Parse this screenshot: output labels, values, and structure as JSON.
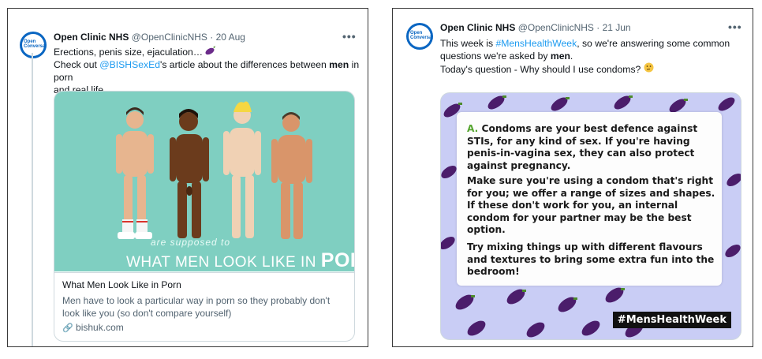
{
  "left": {
    "author": "Open Clinic NHS",
    "handle": "@OpenClinicNHS",
    "date": "· 20 Aug",
    "more": "•••",
    "line1": "Erections, penis size, ejaculation…",
    "line2_pre": "Check out ",
    "mention": "@BISHSexEd",
    "line2_post": "'s article about the differences between ",
    "bold": "men",
    "line2_end": " in porn",
    "line3": "and real life.",
    "poster_sub": "are supposed to",
    "poster_main": "WHAT MEN LOOK LIKE IN",
    "poster_big": "PORN",
    "card_title": "What Men Look Like in Porn",
    "card_desc": "Men have to look a particular way in porn so they probably don't look like you (so don't compare yourself)",
    "card_domain": "bishuk.com"
  },
  "right": {
    "author": "Open Clinic NHS",
    "handle": "@OpenClinicNHS",
    "date": "· 21 Jun",
    "more": "•••",
    "line1_pre": "This week is ",
    "hashtag": "#MensHealthWeek",
    "line1_post": ", so we're answering some common",
    "line2_pre": "questions we're asked by ",
    "bold": "men",
    "line2_post": ".",
    "line3": "Today's question - Why should I use condoms?",
    "qa_label": "A.",
    "para1": "Condoms are your best defence against STIs, for any kind of sex. If you're having penis-in-vagina sex, they can also protect against pregnancy.",
    "para2": "Make sure you're using a condom that's right for you; we offer a range of sizes and shapes. If these don't work for you, an internal condom for your partner may be the best option.",
    "para3": "Try mixing things up with different flavours and textures to bring some extra fun into the bedroom!",
    "badge": "#MensHealthWeek"
  },
  "avatar_text": "Open Conversations"
}
